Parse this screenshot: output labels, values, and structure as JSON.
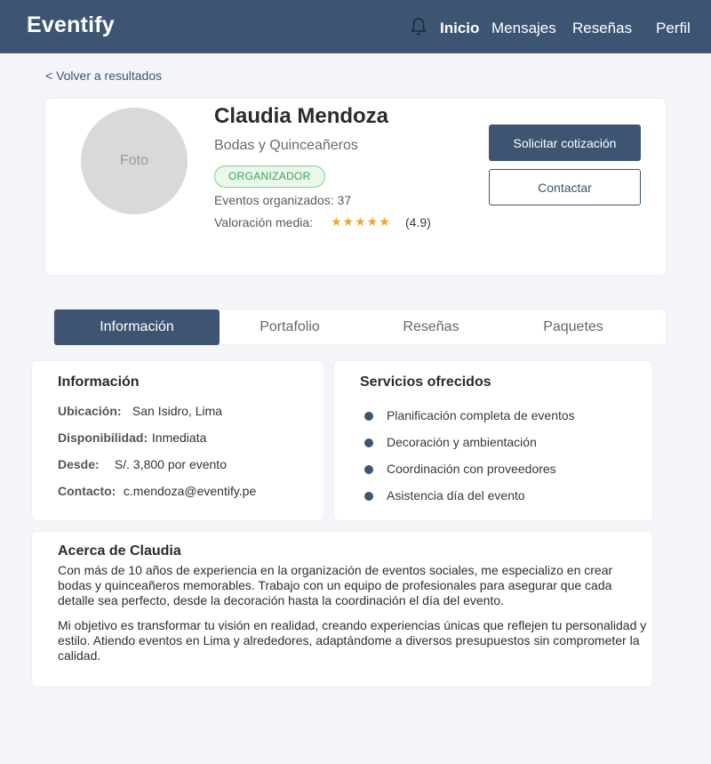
{
  "header": {
    "brand": "Eventify",
    "bell_icon": "bell-icon",
    "nav": [
      "Inicio",
      "Mensajes",
      "Reseñas",
      "Perfil"
    ]
  },
  "back_link": "< Volver a resultados",
  "profile": {
    "photo_label": "Foto",
    "name": "Claudia Mendoza",
    "category": "Bodas y Quinceañeros",
    "badge": "ORGANIZADOR",
    "events_line": "Eventos organizados: 37",
    "rating_label": "Valoración media:",
    "rating_stars": "★★★★★",
    "rating_value": "(4.9)",
    "rating_numeric": 4.9,
    "btn_quote": "Solicitar cotización",
    "btn_contact": "Contactar"
  },
  "tabs": [
    "Información",
    "Portafolio",
    "Reseñas",
    "Paquetes"
  ],
  "info": {
    "title": "Información",
    "rows": [
      {
        "label": "Ubicación:",
        "value": "San Isidro, Lima"
      },
      {
        "label": "Disponibilidad:",
        "value": "Inmediata"
      },
      {
        "label": "Desde:",
        "value": "S/. 3,800 por evento"
      },
      {
        "label": "Contacto:",
        "value": "c.mendoza@eventify.pe"
      }
    ]
  },
  "services": {
    "title": "Servicios ofrecidos",
    "items": [
      "Planificación completa de eventos",
      "Decoración y ambientación",
      "Coordinación con proveedores",
      "Asistencia día del evento"
    ]
  },
  "about": {
    "title": "Acerca de Claudia",
    "p1": "Con más de 10 años de experiencia en la organización de eventos sociales, me especializo en crear bodas y quinceañeros memorables. Trabajo con un equipo de profesionales para asegurar que cada detalle sea perfecto, desde la decoración hasta la coordinación el día del evento.",
    "p2": "Mi objetivo es transformar tu visión en realidad, creando experiencias únicas que reflejen tu personalidad y estilo. Atiendo eventos en Lima y alrededores, adaptándome a diversos presupuestos sin comprometer la calidad."
  },
  "colors": {
    "primary": "#3d5573",
    "badge_green": "#3ba55c",
    "star": "#f4a62a"
  }
}
